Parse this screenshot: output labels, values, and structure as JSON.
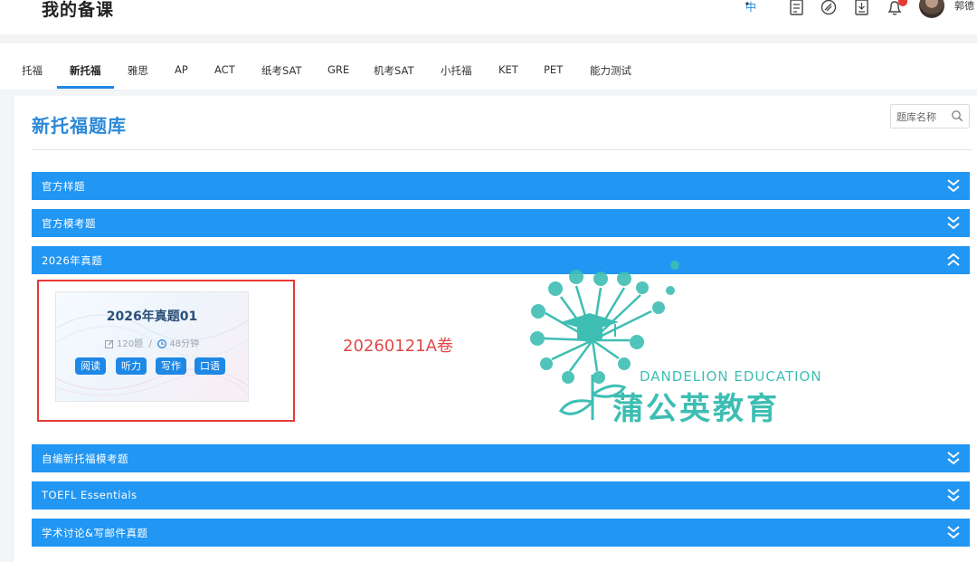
{
  "header": {
    "title": "我的备课",
    "icons": [
      "translate-icon",
      "notebook-icon",
      "link-icon",
      "document-download-icon",
      "bell-icon"
    ],
    "user_name": "郭德"
  },
  "nav": {
    "tabs": [
      {
        "label": "托福",
        "active": false
      },
      {
        "label": "新托福",
        "active": true
      },
      {
        "label": "雅思",
        "active": false
      },
      {
        "label": "AP",
        "active": false
      },
      {
        "label": "ACT",
        "active": false
      },
      {
        "label": "纸考SAT",
        "active": false
      },
      {
        "label": "GRE",
        "active": false
      },
      {
        "label": "机考SAT",
        "active": false
      },
      {
        "label": "小托福",
        "active": false
      },
      {
        "label": "KET",
        "active": false
      },
      {
        "label": "PET",
        "active": false
      },
      {
        "label": "能力测试",
        "active": false
      }
    ]
  },
  "main": {
    "title": "新托福题库",
    "search": {
      "placeholder": "题库名称"
    },
    "sections": [
      {
        "label": "官方样题",
        "expanded": false
      },
      {
        "label": "官方模考题",
        "expanded": false
      },
      {
        "label": "2026年真题",
        "expanded": true
      },
      {
        "label": "自编新托福模考题",
        "expanded": false
      },
      {
        "label": "TOEFL Essentials",
        "expanded": false
      },
      {
        "label": "学术讨论&写邮件真题",
        "expanded": false
      }
    ],
    "paper": {
      "title": "2026年真题01",
      "count": "120题",
      "separator": "/",
      "duration": "48分钟",
      "skills": [
        "阅读",
        "听力",
        "写作",
        "口语"
      ]
    },
    "annotation": "20260121A卷"
  },
  "watermark": {
    "en": "DANDELION EDUCATION",
    "cn": "蒲公英教育"
  },
  "colors": {
    "accent": "#2196f3",
    "title_blue": "#2b88d8",
    "annotation_red": "#e04848",
    "watermark_teal": "#3ebeb3"
  }
}
